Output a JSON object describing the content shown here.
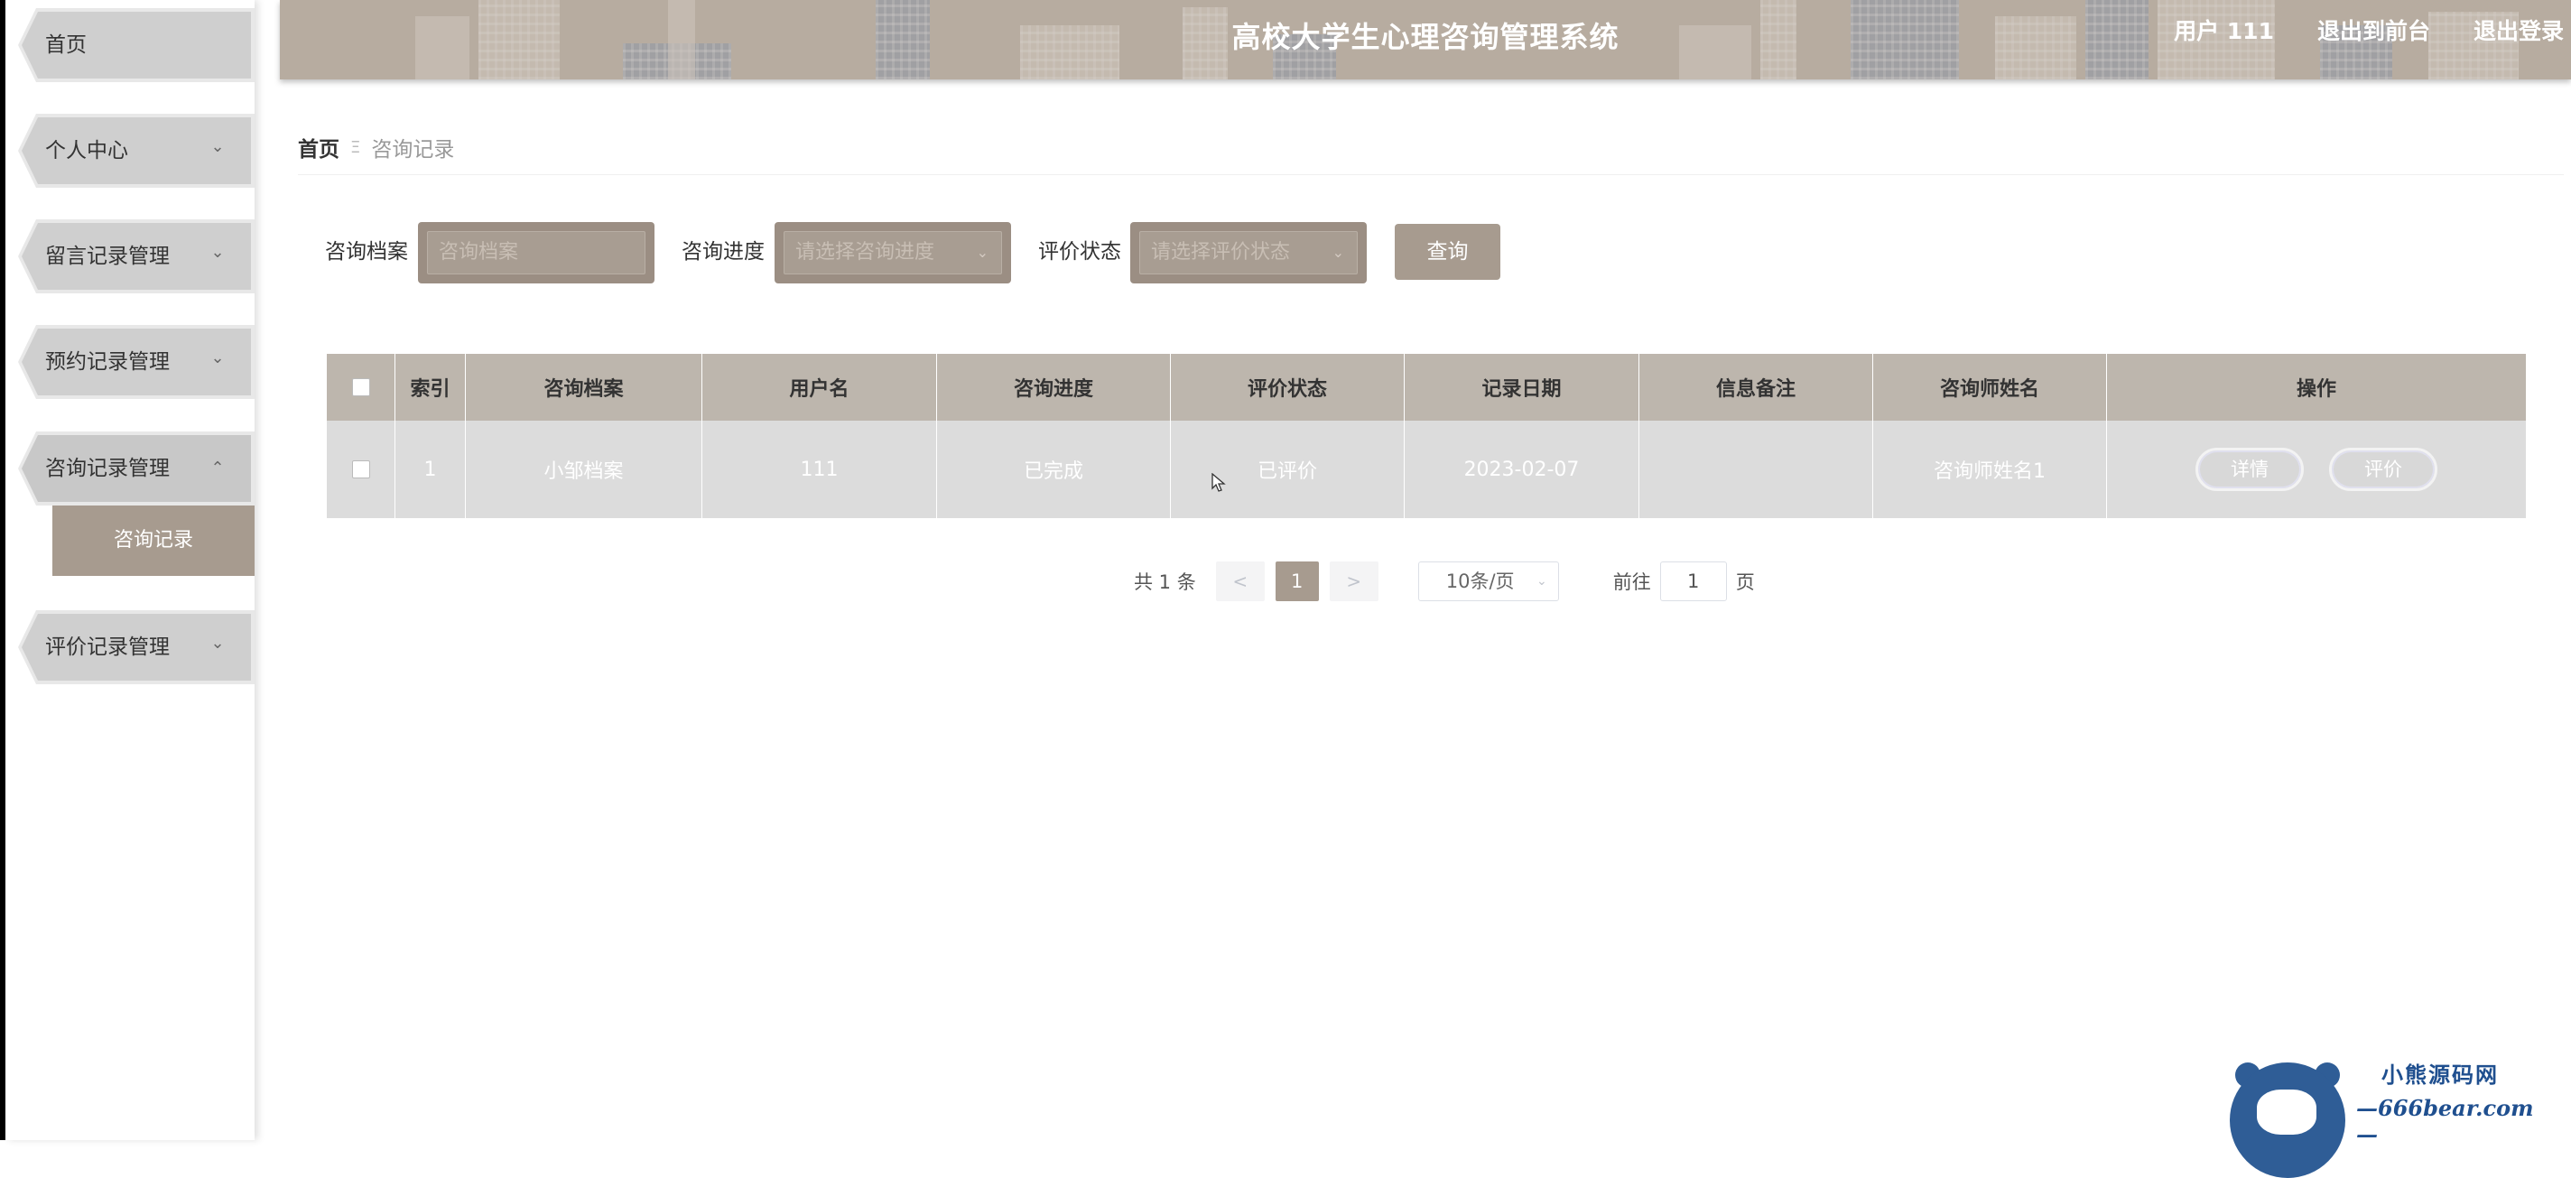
{
  "header": {
    "title": "高校大学生心理咨询管理系统",
    "user": "用户 111",
    "to_front": "退出到前台",
    "logout": "退出登录"
  },
  "sidebar": {
    "items": [
      {
        "label": "首页",
        "has_children": false
      },
      {
        "label": "个人中心",
        "has_children": true
      },
      {
        "label": "留言记录管理",
        "has_children": true
      },
      {
        "label": "预约记录管理",
        "has_children": true
      },
      {
        "label": "咨询记录管理",
        "has_children": true,
        "expanded": true,
        "children": [
          {
            "label": "咨询记录",
            "active": true
          }
        ]
      },
      {
        "label": "评价记录管理",
        "has_children": true
      }
    ]
  },
  "breadcrumb": {
    "home": "首页",
    "separator": "Ξ",
    "current": "咨询记录"
  },
  "search": {
    "archive_label": "咨询档案",
    "archive_placeholder": "咨询档案",
    "progress_label": "咨询进度",
    "progress_placeholder": "请选择咨询进度",
    "eval_label": "评价状态",
    "eval_placeholder": "请选择评价状态",
    "query_button": "查询"
  },
  "table": {
    "columns": [
      "索引",
      "咨询档案",
      "用户名",
      "咨询进度",
      "评价状态",
      "记录日期",
      "信息备注",
      "咨询师姓名",
      "操作"
    ],
    "rows": [
      {
        "index": "1",
        "archive": "小邹档案",
        "username": "111",
        "progress": "已完成",
        "eval_status": "已评价",
        "date": "2023-02-07",
        "note": "",
        "counselor": "咨询师姓名1",
        "actions": [
          "详情",
          "评价"
        ]
      }
    ]
  },
  "pagination": {
    "total": "共 1 条",
    "prev": "<",
    "current_page": "1",
    "next": ">",
    "page_size": "10条/页",
    "goto_prefix": "前往",
    "goto_value": "1",
    "goto_suffix": "页"
  },
  "watermark": {
    "cn": "小熊源码网",
    "en": "—666bear.com—"
  },
  "colors": {
    "accent": "#a79b8f",
    "header_bg": "#b7aca0",
    "table_head": "#bdb6ad",
    "table_row": "#dcdcdc",
    "watermark": "#2f5d96"
  }
}
